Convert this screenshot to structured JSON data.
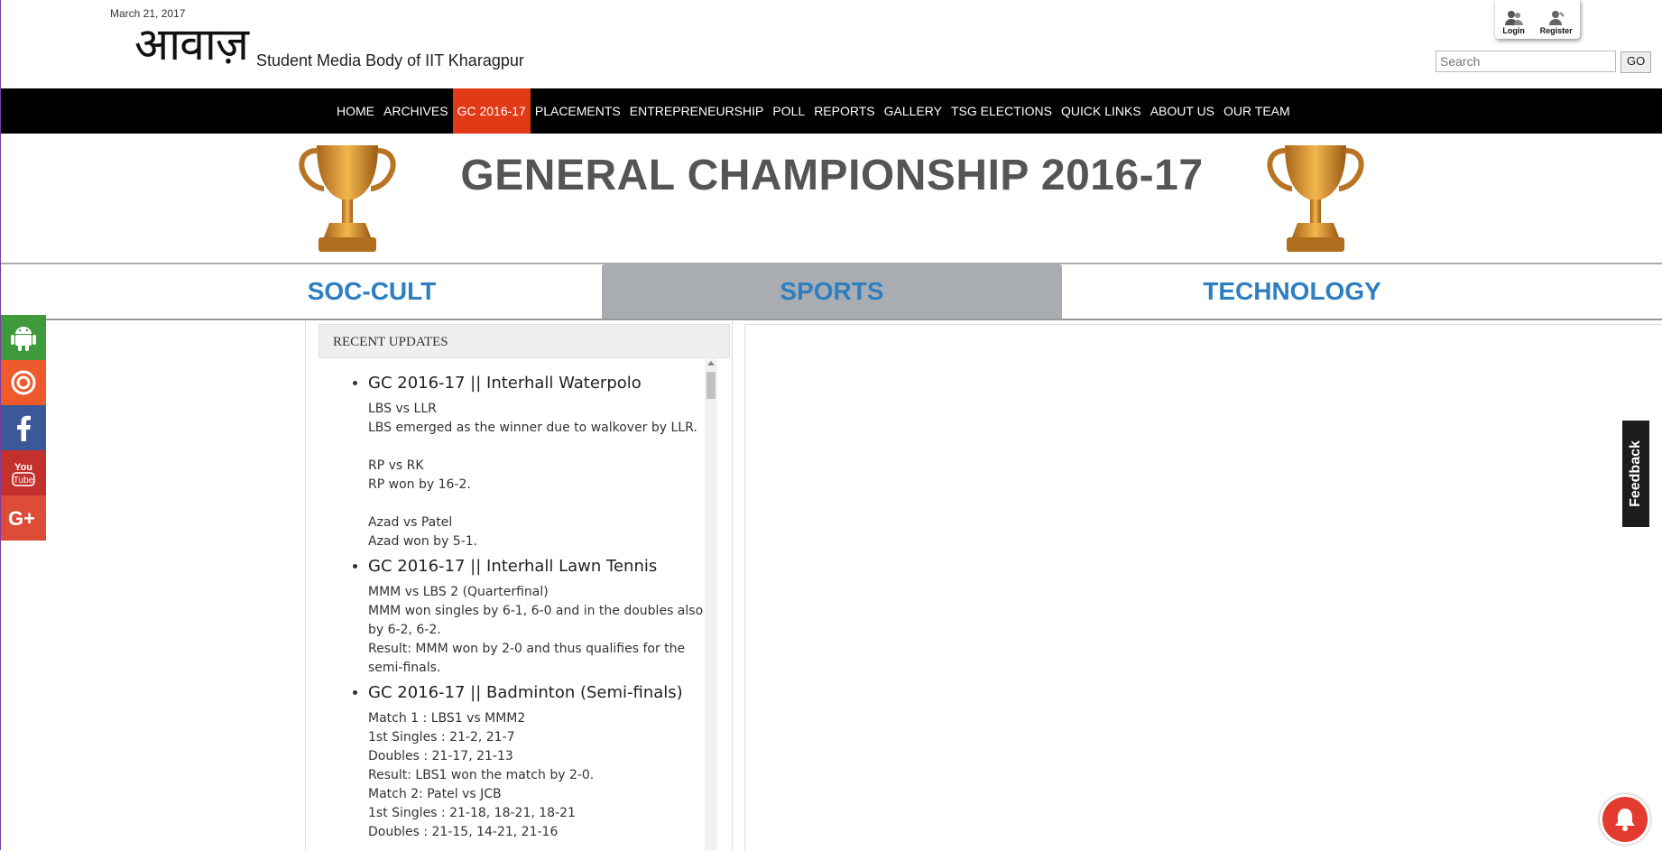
{
  "header": {
    "date": "March 21, 2017",
    "logo_text": "आवाज़",
    "tagline": "Student Media Body of IIT Kharagpur",
    "login_label": "Login",
    "register_label": "Register",
    "search_placeholder": "Search",
    "go_label": "GO"
  },
  "nav": {
    "items": [
      "HOME",
      "ARCHIVES",
      "GC 2016-17",
      "PLACEMENTS",
      "ENTREPRENEURSHIP",
      "POLL",
      "REPORTS",
      "GALLERY",
      "TSG ELECTIONS",
      "QUICK LINKS",
      "ABOUT US",
      "OUR TEAM"
    ],
    "active": "GC 2016-17",
    "active_color": "#e03a17"
  },
  "banner": {
    "title": "GENERAL CHAMPIONSHIP 2016-17"
  },
  "tabs": {
    "items": [
      "SOC-CULT",
      "SPORTS",
      "TECHNOLOGY"
    ],
    "active": "SPORTS"
  },
  "social": [
    {
      "icon": "android-icon",
      "color": "#3e9a3b"
    },
    {
      "icon": "target-icon",
      "color": "#ee5a2c"
    },
    {
      "icon": "facebook-icon",
      "color": "#3b5998"
    },
    {
      "icon": "youtube-icon",
      "color": "#c4302b"
    },
    {
      "icon": "google-plus-icon",
      "color": "#dd4b39"
    }
  ],
  "recent_updates": {
    "heading": "RECENT UPDATES",
    "items": [
      {
        "title": "GC 2016-17 || Interhall Waterpolo",
        "body": "LBS vs LLR\nLBS emerged as the winner due to walkover by LLR.\n\nRP vs RK\nRP won by 16-2.\n\nAzad vs Patel\nAzad won by 5-1."
      },
      {
        "title": "GC 2016-17 || Interhall Lawn Tennis",
        "body": "MMM vs LBS 2 (Quarterfinal)\nMMM won singles by 6-1, 6-0 and in the doubles also by 6-2, 6-2.\nResult: MMM won by 2-0 and thus qualifies for the semi-finals."
      },
      {
        "title": "GC 2016-17 || Badminton (Semi-finals)",
        "body": "Match 1 : LBS1 vs MMM2\n1st Singles : 21-2, 21-7\nDoubles : 21-17, 21-13\nResult: LBS1 won the match by 2-0.\nMatch 2: Patel vs JCB\n1st Singles : 21-18, 18-21, 18-21\nDoubles : 21-15, 14-21, 21-16"
      }
    ]
  },
  "feedback_label": "Feedback"
}
